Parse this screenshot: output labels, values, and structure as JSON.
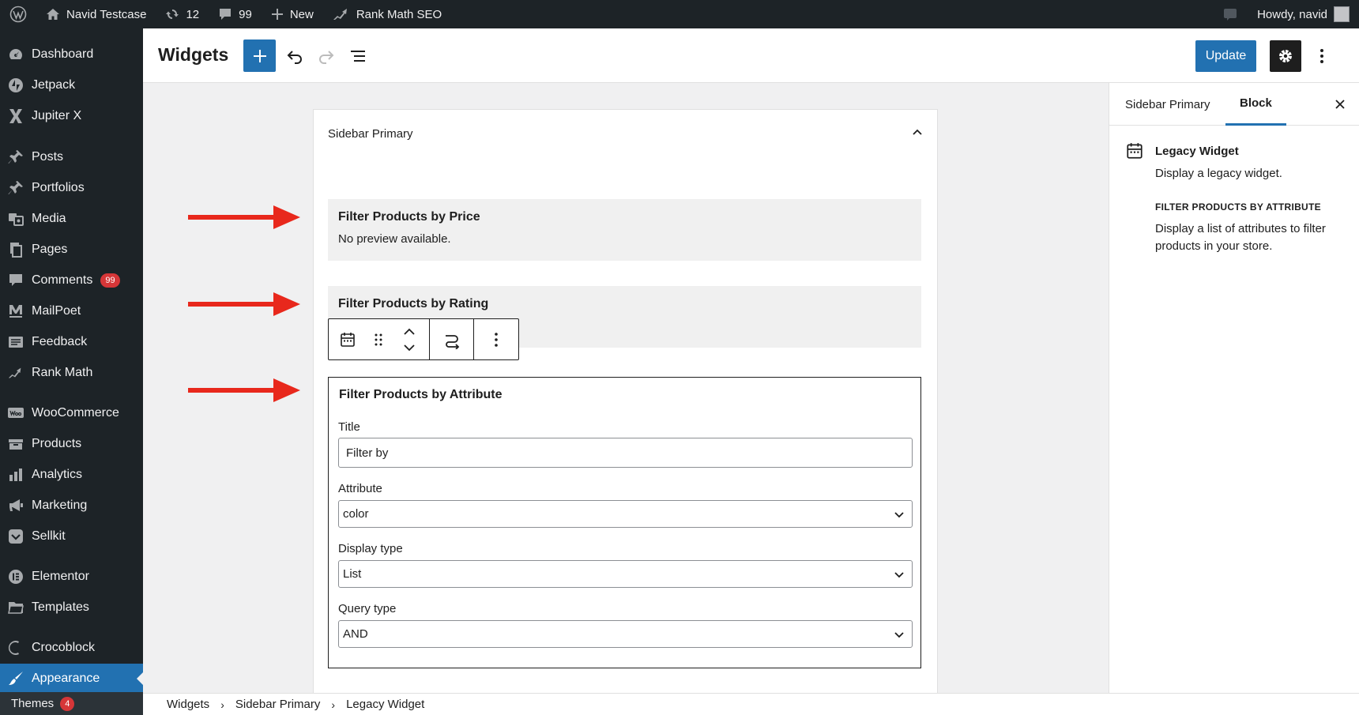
{
  "admin_bar": {
    "site_name": "Navid Testcase",
    "updates_count": "12",
    "comments_count": "99",
    "new_label": "New",
    "seo_label": "Rank Math SEO",
    "greeting": "Howdy, navid"
  },
  "menu": {
    "items": [
      {
        "label": "Dashboard",
        "icon": "dashboard-icon"
      },
      {
        "label": "Jetpack",
        "icon": "jetpack-icon"
      },
      {
        "label": "Jupiter X",
        "icon": "jupiter-x-icon"
      },
      {
        "label": "Posts",
        "icon": "pin-icon"
      },
      {
        "label": "Portfolios",
        "icon": "pin-icon"
      },
      {
        "label": "Media",
        "icon": "media-icon"
      },
      {
        "label": "Pages",
        "icon": "pages-icon"
      },
      {
        "label": "Comments",
        "icon": "comments-icon",
        "badge": "99"
      },
      {
        "label": "MailPoet",
        "icon": "mailpoet-icon"
      },
      {
        "label": "Feedback",
        "icon": "feedback-icon"
      },
      {
        "label": "Rank Math",
        "icon": "rank-math-icon"
      },
      {
        "label": "WooCommerce",
        "icon": "woocommerce-icon"
      },
      {
        "label": "Products",
        "icon": "products-icon"
      },
      {
        "label": "Analytics",
        "icon": "analytics-icon"
      },
      {
        "label": "Marketing",
        "icon": "megaphone-icon"
      },
      {
        "label": "Sellkit",
        "icon": "sellkit-icon"
      },
      {
        "label": "Elementor",
        "icon": "elementor-icon"
      },
      {
        "label": "Templates",
        "icon": "folder-icon"
      },
      {
        "label": "Crocoblock",
        "icon": "crocoblock-icon"
      },
      {
        "label": "Appearance",
        "icon": "brush-icon",
        "current": true
      }
    ],
    "submenu": {
      "label": "Themes",
      "badge": "4"
    }
  },
  "header": {
    "title": "Widgets",
    "update_label": "Update"
  },
  "widget_area": {
    "title": "Sidebar Primary",
    "blocks": [
      {
        "title": "Filter Products by Price",
        "description": "No preview available."
      },
      {
        "title": "Filter Products by Rating"
      }
    ],
    "form_block": {
      "title": "Filter Products by Attribute",
      "title_label": "Title",
      "title_value": "Filter by",
      "attribute_label": "Attribute",
      "attribute_value": "color",
      "display_type_label": "Display type",
      "display_type_value": "List",
      "query_type_label": "Query type",
      "query_type_value": "AND"
    }
  },
  "sidebar": {
    "tabs": [
      "Sidebar Primary",
      "Block"
    ],
    "active_tab": "Block",
    "card_title": "Legacy Widget",
    "card_desc": "Display a legacy widget.",
    "section_title": "FILTER PRODUCTS BY ATTRIBUTE",
    "section_desc": "Display a list of attributes to filter products in your store."
  },
  "breadcrumb": [
    "Widgets",
    "Sidebar Primary",
    "Legacy Widget"
  ],
  "colors": {
    "admin_dark": "#1d2327",
    "accent": "#2271b1",
    "annotation_arrow": "#e8281c",
    "badge_red": "#d63638"
  }
}
